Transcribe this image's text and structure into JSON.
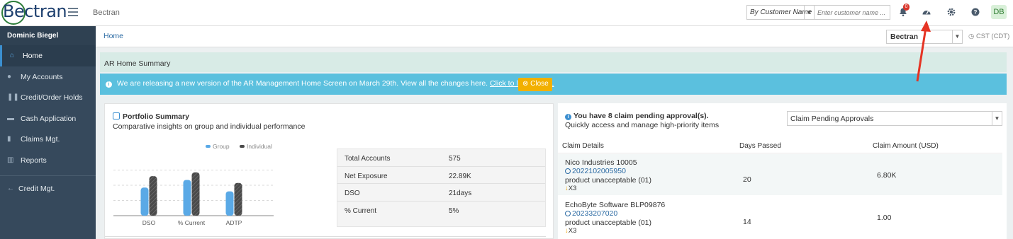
{
  "topbar": {
    "logo_text": "Bectran",
    "title": "Bectran",
    "search_by": "By Customer Name",
    "search_placeholder": "Enter customer name ...",
    "notif_count": "0",
    "avatar_initials": "DB",
    "icons": [
      "hamburger-icon",
      "bell-icon",
      "dashboard-icon",
      "gear-icon",
      "help-icon"
    ]
  },
  "sidebar": {
    "user": "Dominic Biegel",
    "items": [
      {
        "label": "Home",
        "icon": "home-icon",
        "active": true
      },
      {
        "label": "My Accounts",
        "icon": "user-icon"
      },
      {
        "label": "Credit/Order Holds",
        "icon": "pause-icon"
      },
      {
        "label": "Cash Application",
        "icon": "cash-icon"
      },
      {
        "label": "Claims Mgt.",
        "icon": "document-icon"
      },
      {
        "label": "Reports",
        "icon": "chart-icon"
      }
    ],
    "footer_item": {
      "label": "Credit Mgt.",
      "icon": "back-arrow-icon"
    }
  },
  "breadcrumb": {
    "home": "Home"
  },
  "tenant_select": "Bectran",
  "timezone": "CST (CDT)",
  "summary": {
    "title": "AR Home Summary"
  },
  "banner": {
    "text": "We are releasing a new version of the AR Management Home Screen on March 29th. View all the changes here.",
    "link": "Click to learn more.",
    "close": "Close"
  },
  "portfolio": {
    "title": "Portfolio Summary",
    "subtitle": "Comparative insights on group and individual performance",
    "stats": [
      {
        "key": "Total Accounts",
        "value": "575"
      },
      {
        "key": "Net Exposure",
        "value": "22.89K"
      },
      {
        "key": "DSO",
        "value": "21days"
      },
      {
        "key": "% Current",
        "value": "5%"
      }
    ]
  },
  "chart_data": {
    "type": "bar",
    "categories": [
      "DSO",
      "% Current",
      "ADTP"
    ],
    "series": [
      {
        "name": "Group",
        "values": [
          37,
          47,
          32
        ],
        "color": "#5aa9e6"
      },
      {
        "name": "Individual",
        "values": [
          52,
          57,
          43
        ],
        "color": "#4a4a4a"
      }
    ],
    "ylim": [
      0,
      80
    ],
    "grid": true,
    "legend": "top"
  },
  "pending": {
    "title": "You have 8 claim pending approval(s).",
    "subtitle": "Quickly access and manage high-priority items",
    "select": "Claim Pending Approvals",
    "columns": [
      "Claim Details",
      "Days Passed",
      "Claim Amount (USD)"
    ],
    "rows": [
      {
        "customer": "Nico Industries  10005",
        "claim_id": "2022102005950",
        "reason": "product unacceptable (01)",
        "x": "X3",
        "days": "20",
        "amount": "6.80K"
      },
      {
        "customer": "EchoByte Software  BLP09876",
        "claim_id": "20233207020",
        "reason": "product unacceptable (01)",
        "x": "X3",
        "days": "14",
        "amount": "1.00"
      }
    ]
  }
}
